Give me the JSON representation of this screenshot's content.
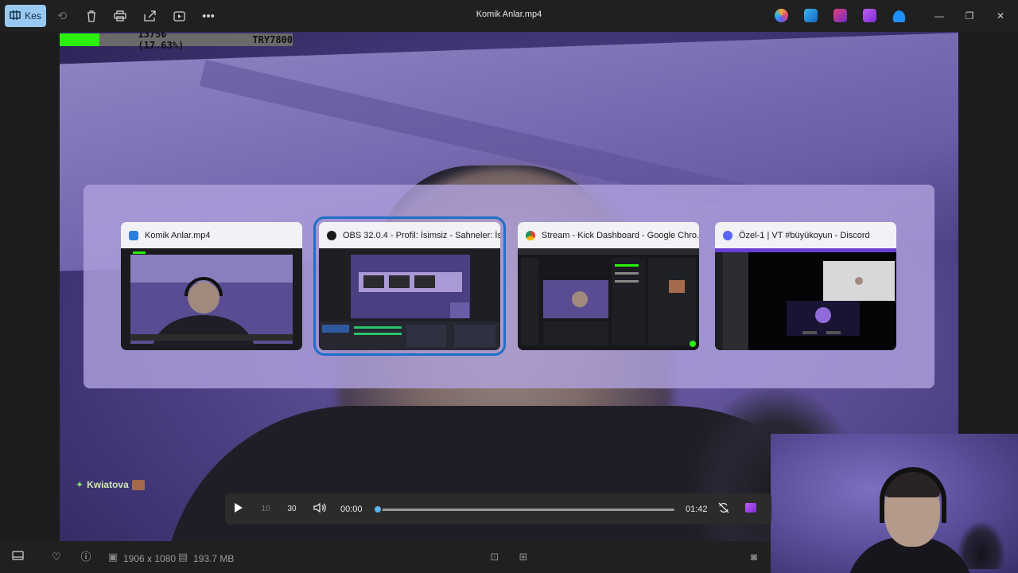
{
  "toolbar": {
    "kes_label": "Kes",
    "title": "Komik Anlar.mp4",
    "icons": [
      "trim-icon",
      "rotate-icon",
      "delete-icon",
      "print-icon",
      "share-icon",
      "slideshow-icon",
      "more-icon"
    ],
    "app_icons": [
      "copilot-icon",
      "photos-app-icon",
      "clipchamp-icon",
      "video-editor-icon",
      "onedrive-icon"
    ]
  },
  "overlay": {
    "donation_percent": "1375₺ (17.63%)",
    "donation_goal": "TRY7800",
    "progress_fraction": 0.1763,
    "chat_username": "Kwiatova"
  },
  "switcher": {
    "windows": [
      {
        "title": "Komik Anlar.mp4",
        "icon": "photos-icon",
        "icon_color": "#2b7fd8",
        "selected": false
      },
      {
        "title": "OBS 32.0.4 - Profil: İsimsiz - Sahneler: İsi...",
        "icon": "obs-icon",
        "icon_color": "#1b1b1b",
        "selected": true
      },
      {
        "title": "Stream - Kick Dashboard - Google Chro...",
        "icon": "chrome-icon",
        "icon_color": "#e3a21a",
        "selected": false
      },
      {
        "title": "Özel-1 | VT #büyükoyun - Discord",
        "icon": "discord-icon",
        "icon_color": "#5865f2",
        "selected": false
      }
    ]
  },
  "player": {
    "current_time": "00:00",
    "total_time": "01:42",
    "progress_fraction": 0.0,
    "skip_back_label": "10",
    "skip_forward_label": "30"
  },
  "statusbar": {
    "resolution": "1906 x 1080",
    "file_size": "193.7 MB"
  },
  "colors": {
    "accent": "#99c8f2",
    "selection": "#1f6fc8",
    "scrub": "#5ab4ee",
    "donation_bar": "#29f10c"
  }
}
